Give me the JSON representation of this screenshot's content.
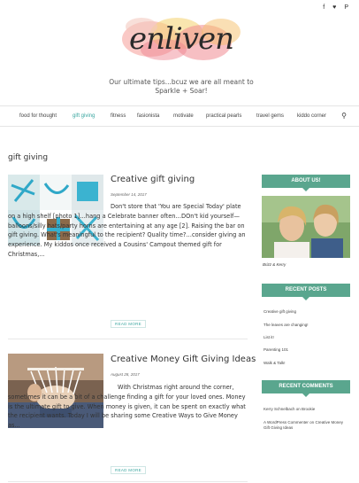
{
  "social": [
    {
      "icon": "facebook-icon",
      "glyph": "f"
    },
    {
      "icon": "twitter-icon",
      "glyph": "♥"
    },
    {
      "icon": "pinterest-icon",
      "glyph": "P"
    }
  ],
  "logo_text": "enliven",
  "tagline": "Our ultimate tips...bcuz we are all meant to Sparkle + Soar!",
  "nav": {
    "items": [
      "food for thought",
      "gift giving",
      "fitness",
      "fasionista",
      "motivate",
      "practical pearls",
      "travel gems",
      "kiddo corner"
    ],
    "active": "gift giving",
    "search_icon": "⚲"
  },
  "page_title": "gift giving",
  "posts": [
    {
      "title": "Creative gift giving",
      "date": "September 14, 2017",
      "excerpt": "Don't store that 'You are Special Today' plate on a high shelf [photo 1]…hang a Celebrate banner often…DOn't kid yourself—balloons/silly hats/party horns are entertaining at any age [2]. Raising the bar on gift giving. What's meaningful to the recipient? Quality time?…consider giving an experience. My kiddos once received a Cousins' Campout themed gift for Christmas,...",
      "read_more": "READ MORE"
    },
    {
      "title": "Creative Money Gift Giving Ideas",
      "date": "August 28, 2017",
      "excerpt": "With Christmas right around the corner, sometimes it can be a bit of a challenge finding a gift for your loved ones. Money is the ultimate gift to give. When money is given, it can be spent on exactly what the recipient wants. Today I will be sharing some Creative Ways to Give Money as...",
      "read_more": "READ MORE"
    }
  ],
  "sidebar": {
    "about_title": "ABOUT US!",
    "about_caption": "Brizz & Kerry",
    "recent_posts_title": "RECENT POSTS",
    "recent_posts": [
      "Creative gift giving",
      "The leaves are changing!",
      "List it!",
      "Parenting 101",
      "Walk & Talk!"
    ],
    "recent_comments_title": "RECENT COMMENTS",
    "recent_comments": [
      "Kerry Schnelbach on Brookie",
      "A WordPress Commenter on Creative Money Gift Giving Ideas"
    ]
  },
  "colors": {
    "accent": "#3aa6a0",
    "widget": "#5aa68e"
  }
}
